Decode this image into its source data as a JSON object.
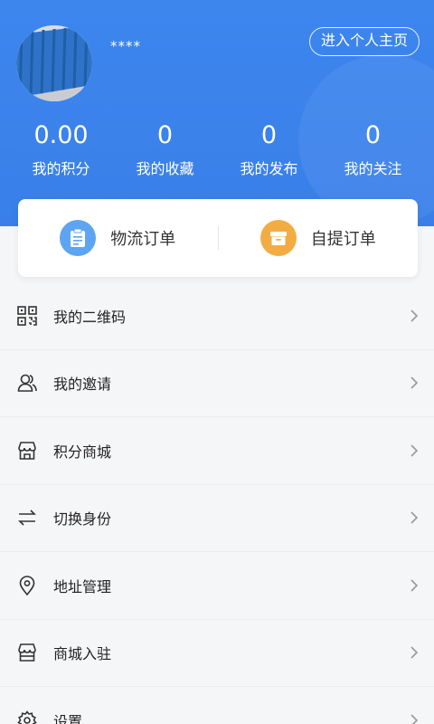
{
  "profile": {
    "username": "****",
    "home_button": "进入个人主页"
  },
  "stats": [
    {
      "value": "0.00",
      "label": "我的积分"
    },
    {
      "value": "0",
      "label": "我的收藏"
    },
    {
      "value": "0",
      "label": "我的发布"
    },
    {
      "value": "0",
      "label": "我的关注"
    }
  ],
  "orders": [
    {
      "label": "物流订单",
      "icon": "clipboard-icon",
      "color": "#5da4f2"
    },
    {
      "label": "自提订单",
      "icon": "box-icon",
      "color": "#f1ad44"
    }
  ],
  "menu": [
    {
      "label": "我的二维码",
      "icon": "qrcode-icon"
    },
    {
      "label": "我的邀请",
      "icon": "users-icon"
    },
    {
      "label": "积分商城",
      "icon": "store-icon"
    },
    {
      "label": "切换身份",
      "icon": "swap-icon"
    },
    {
      "label": "地址管理",
      "icon": "location-pin-icon"
    },
    {
      "label": "商城入驻",
      "icon": "shop-icon"
    },
    {
      "label": "设置",
      "icon": "gear-icon"
    }
  ],
  "colors": {
    "header": "#3a7fe9",
    "background": "#f5f6f8"
  }
}
